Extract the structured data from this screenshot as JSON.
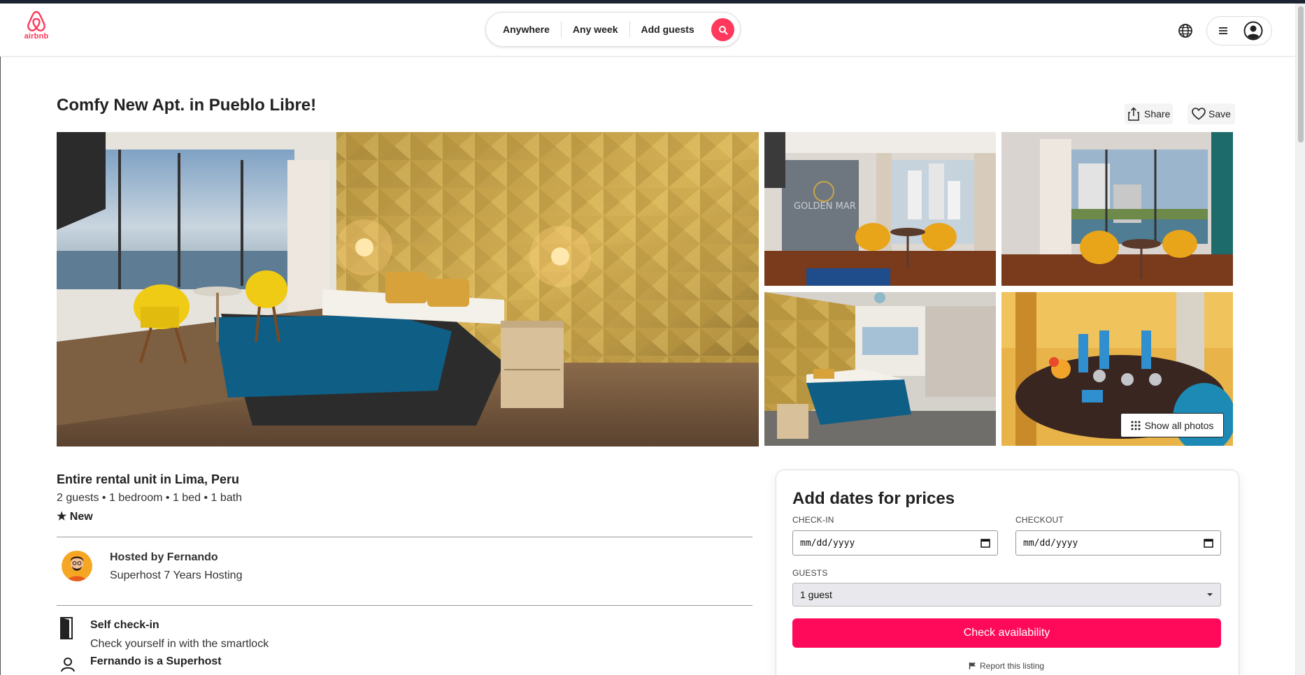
{
  "header": {
    "logo_text": "airbnb",
    "search": {
      "anywhere": "Anywhere",
      "any_week": "Any week",
      "add_guests": "Add guests"
    }
  },
  "listing": {
    "title": "Comfy New Apt. in Pueblo Libre!",
    "share_label": "Share",
    "save_label": "Save",
    "show_all_photos": "Show all photos",
    "subtitle": "Entire rental unit in Lima, Peru",
    "details": "2 guests • 1 bedroom • 1 bed • 1 bath",
    "rating": "★ New",
    "host": {
      "name": "Hosted by Fernando",
      "sub": "Superhost 7 Years Hosting"
    },
    "features": [
      {
        "title": "Self check-in",
        "sub": "Check yourself in with the smartlock",
        "icon": "door-icon"
      },
      {
        "title": "Fernando is a Superhost",
        "sub": "",
        "icon": "person-icon"
      }
    ]
  },
  "booking": {
    "title": "Add dates for prices",
    "checkin_label": "CHECK-IN",
    "checkout_label": "CHECKOUT",
    "checkin_value": "mm/dd/yyyy",
    "checkout_value": "mm/dd/yyyy",
    "guests_label": "GUESTS",
    "guests_value": "1 guest",
    "check_button": "Check availability",
    "report": "Report this listing"
  },
  "colors": {
    "brand": "#ff385c",
    "button": "#ff0a5a"
  }
}
